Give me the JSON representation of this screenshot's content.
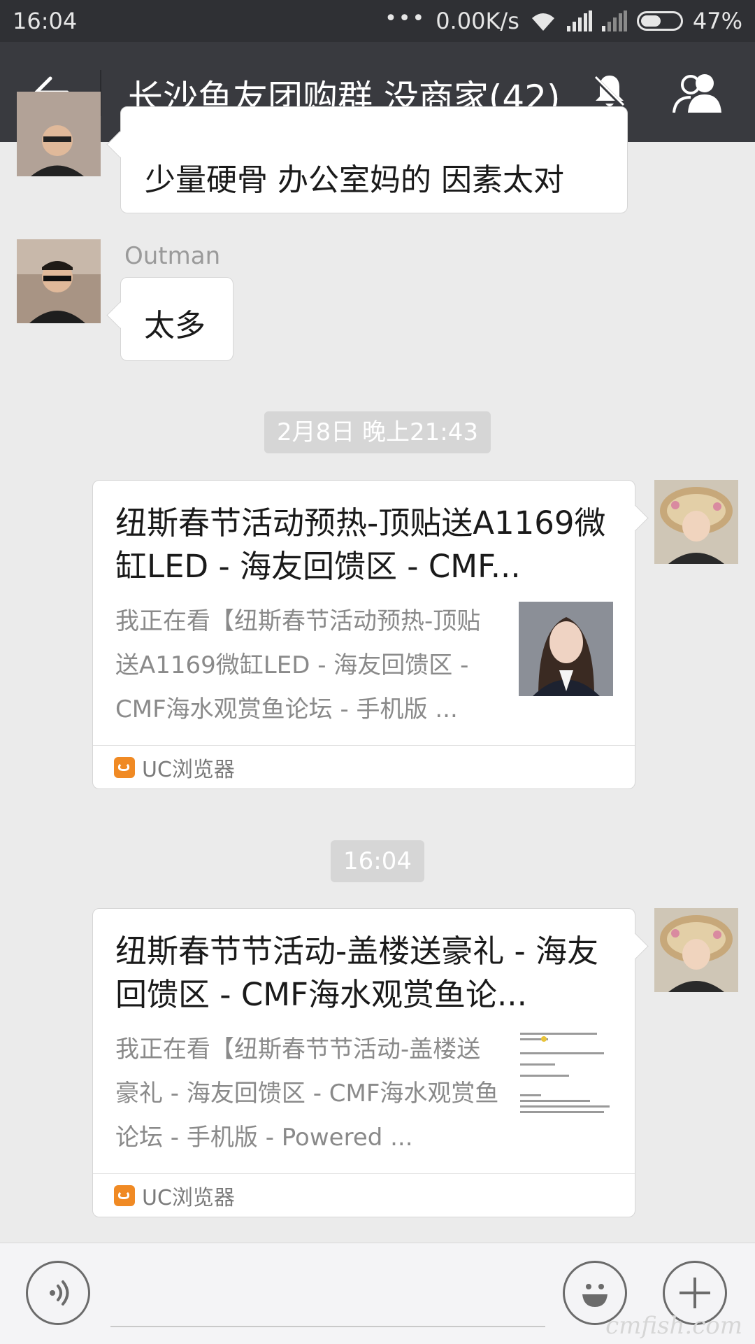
{
  "status_bar": {
    "time": "16:04",
    "network_speed": "0.00K/s",
    "battery": "47%",
    "battery_level": 0.47
  },
  "header": {
    "title": "长沙鱼友团购群 没商家(42)",
    "icons": [
      "back-arrow-icon",
      "mute-bell-icon",
      "group-members-icon"
    ]
  },
  "messages": [
    {
      "type": "text",
      "side": "left",
      "text": "少量硬骨  办公室妈的 因素太对"
    },
    {
      "type": "text",
      "side": "left",
      "sender": "Outman",
      "text": "太多"
    },
    {
      "type": "timestamp",
      "text": "2月8日 晚上21:43"
    },
    {
      "type": "link_card",
      "side": "right",
      "title": "纽斯春节活动预热-顶贴送A1169微缸LED - 海友回馈区 - CMF...",
      "description": "我正在看【纽斯春节活动预热-顶贴送A1169微缸LED - 海友回馈区 - CMF海水观赏鱼论坛 - 手机版 ...",
      "source": "UC浏览器"
    },
    {
      "type": "timestamp",
      "text": "16:04"
    },
    {
      "type": "link_card",
      "side": "right",
      "title": "纽斯春节节活动-盖楼送豪礼 - 海友回馈区 - CMF海水观赏鱼论...",
      "description": "我正在看【纽斯春节节活动-盖楼送豪礼 - 海友回馈区 - CMF海水观赏鱼论坛 - 手机版 - Powered ...",
      "source": "UC浏览器"
    }
  ],
  "input_bar": {
    "icons": [
      "voice-input-icon",
      "emoji-icon",
      "plus-icon"
    ]
  },
  "watermark": "cmfish.com",
  "colors": {
    "status_bar_bg": "#2f3034",
    "title_bar_bg": "#393a3f",
    "chat_bg": "#ebebeb",
    "bubble_bg": "#ffffff",
    "timestamp_bg": "#d6d6d6",
    "uc_orange": "#f08a24"
  }
}
